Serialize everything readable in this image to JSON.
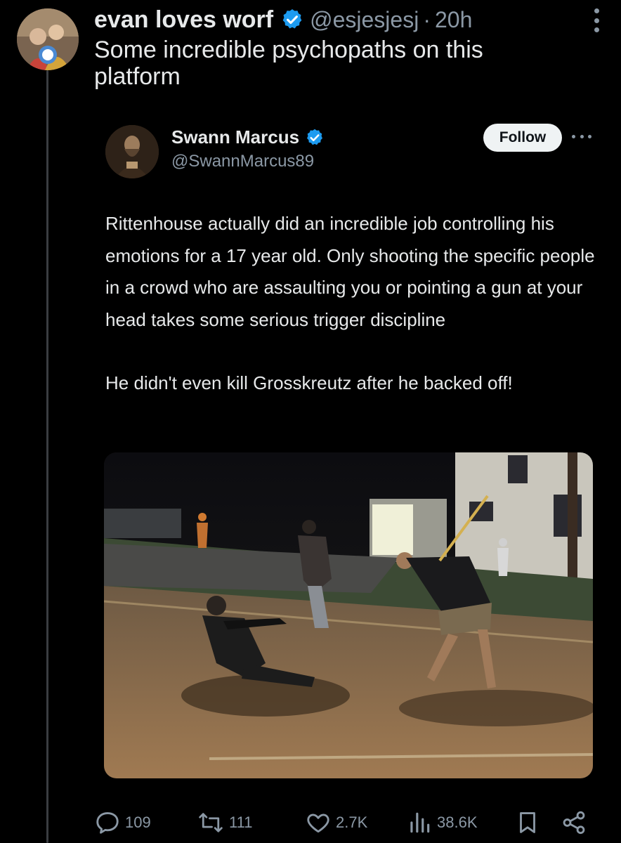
{
  "tweet": {
    "display_name": "evan loves worf",
    "handle": "@esjesjesj",
    "separator": "·",
    "time": "20h",
    "text": "Some incredible psychopaths on this platform"
  },
  "quote": {
    "display_name": "Swann Marcus",
    "handle": "@SwannMarcus89",
    "follow_label": "Follow",
    "paragraphs": [
      "Rittenhouse actually did an incredible job controlling his emotions for a 17 year old. Only shooting the specific people in a crowd who are assaulting you or pointing a gun at your head takes some serious trigger discipline",
      "He didn't even kill Grosskreutz after he backed off!"
    ]
  },
  "actions": {
    "replies": "109",
    "reposts": "111",
    "likes": "2.7K",
    "views": "38.6K"
  },
  "icons": {
    "verified": "verified-badge-icon",
    "more": "more-icon",
    "reply": "reply-icon",
    "repost": "repost-icon",
    "like": "heart-icon",
    "views": "views-icon",
    "bookmark": "bookmark-icon",
    "share": "share-icon"
  },
  "colors": {
    "background": "#000000",
    "text": "#e7e9ea",
    "muted": "#8b98a5",
    "verified": "#1d9bf0",
    "follow_bg": "#eff3f4"
  }
}
